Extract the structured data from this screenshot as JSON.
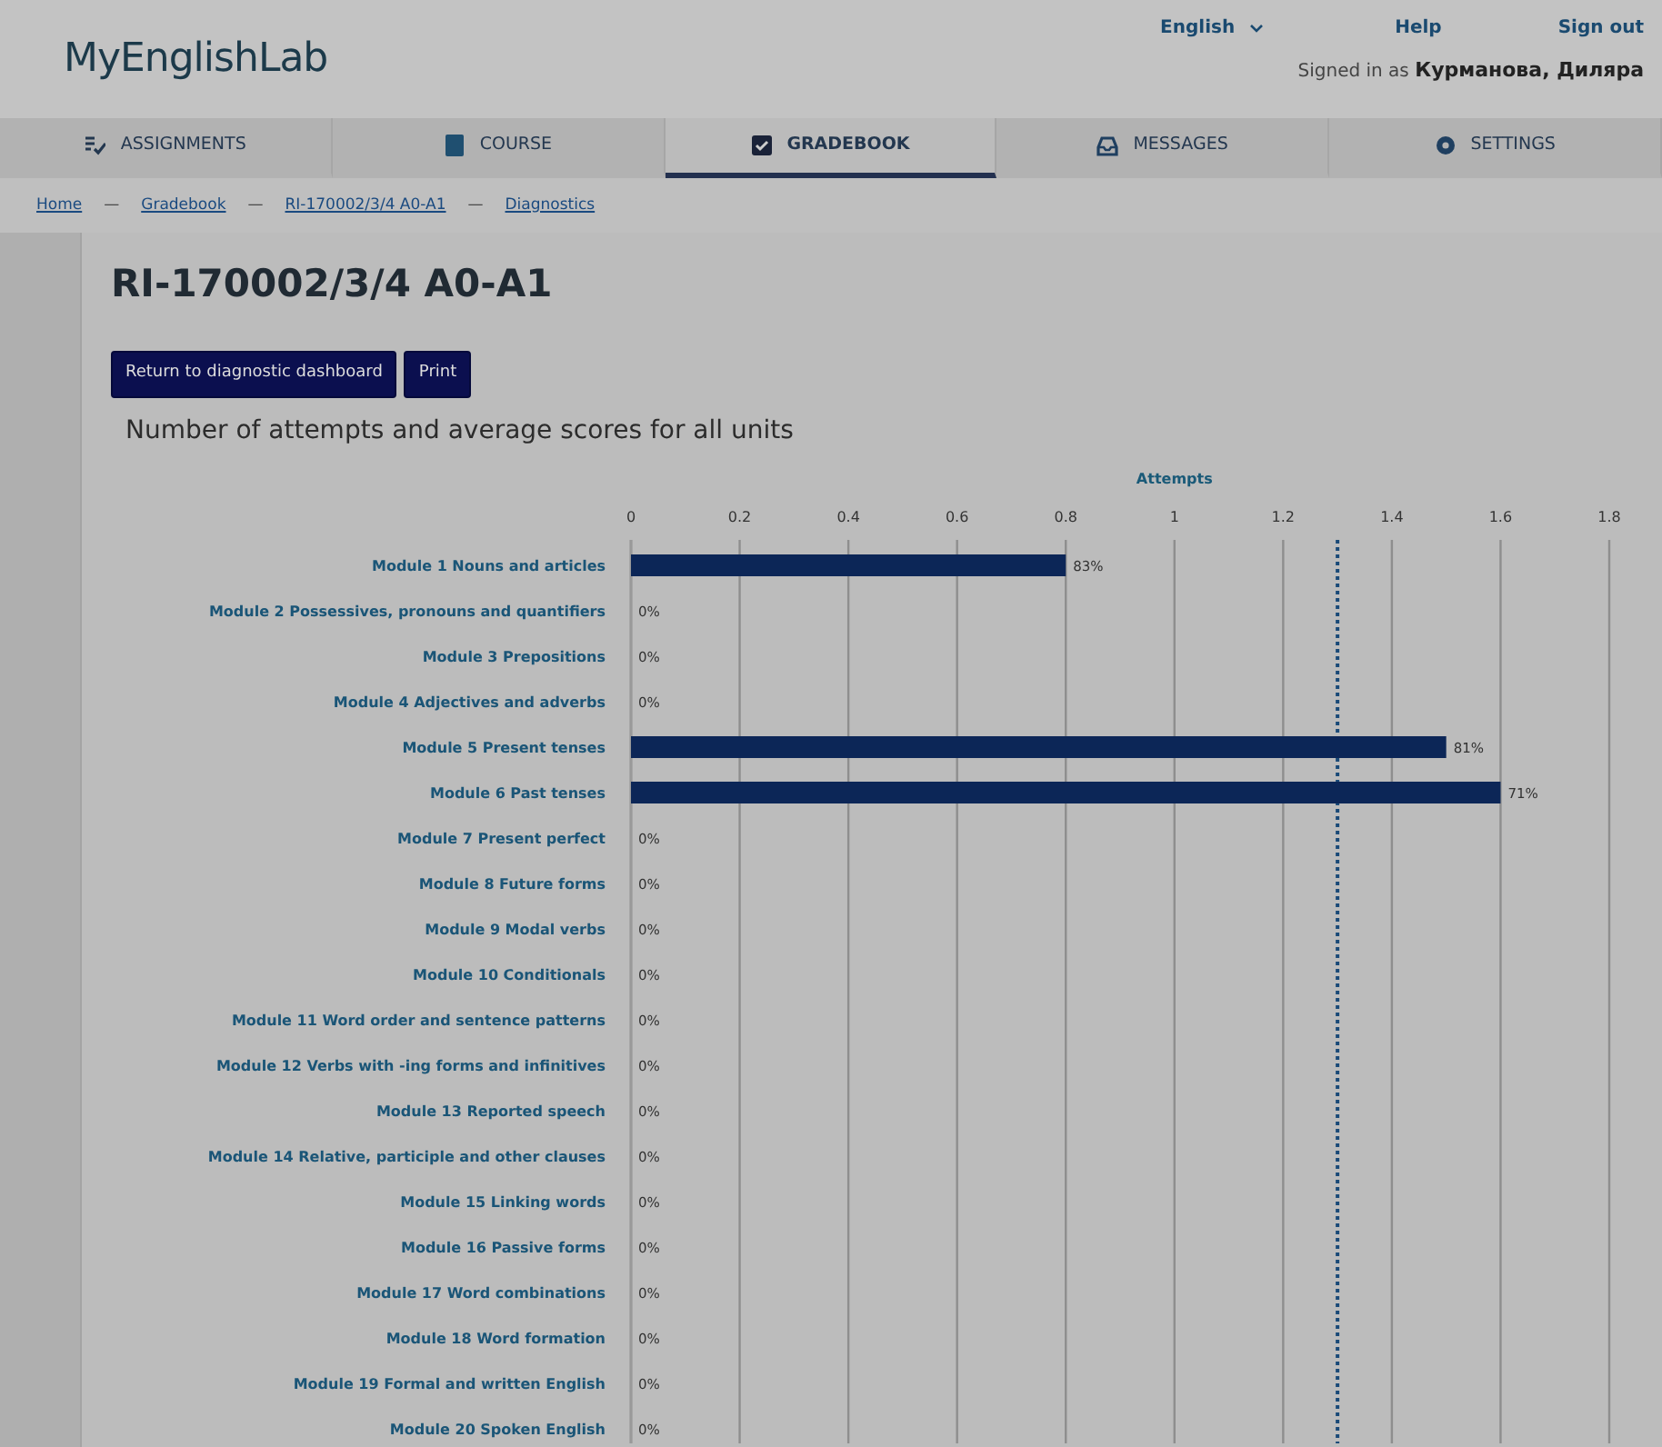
{
  "header": {
    "logo": "MyEnglishLab",
    "language": "English",
    "help": "Help",
    "sign_out": "Sign out",
    "signed_in_label": "Signed in as",
    "user_name": "Курманова, Диляра"
  },
  "tabs": [
    {
      "label": "ASSIGNMENTS",
      "selected": false
    },
    {
      "label": "COURSE",
      "selected": false
    },
    {
      "label": "GRADEBOOK",
      "selected": true
    },
    {
      "label": "MESSAGES",
      "selected": false
    },
    {
      "label": "SETTINGS",
      "selected": false
    }
  ],
  "breadcrumb": [
    {
      "kind": "link",
      "text": "Home"
    },
    {
      "kind": "separator",
      "text": "—"
    },
    {
      "kind": "link",
      "text": "Gradebook"
    },
    {
      "kind": "separator",
      "text": "—"
    },
    {
      "kind": "link",
      "text": "RI-170002/3/4 A0-A1"
    },
    {
      "kind": "separator",
      "text": "—"
    },
    {
      "kind": "link",
      "text": "Diagnostics"
    }
  ],
  "page_title": "RI-170002/3/4 A0-A1",
  "buttons": [
    "Return to diagnostic dashboard",
    "Print"
  ],
  "section_title": "Number of attempts and average scores for all units",
  "chart": {
    "score_labels": [
      "83%",
      "0%",
      "0%",
      "0%",
      "81%",
      "71%",
      "0%",
      "0%",
      "0%",
      "0%",
      "0%",
      "0%",
      "0%",
      "0%",
      "0%",
      "0%",
      "0%",
      "0%",
      "0%",
      "0%"
    ],
    "chart_data": {
      "type": "bar",
      "orientation": "horizontal",
      "xlabel": "Attempts",
      "categories": [
        "Module 1 Nouns and articles",
        "Module 2 Possessives, pronouns and quantifiers",
        "Module 3 Prepositions",
        "Module 4 Adjectives and adverbs",
        "Module 5 Present tenses",
        "Module 6 Past tenses",
        "Module 7 Present perfect",
        "Module 8 Future forms",
        "Module 9 Modal verbs",
        "Module 10 Conditionals",
        "Module 11 Word order and sentence patterns",
        "Module 12 Verbs with -ing forms and infinitives",
        "Module 13 Reported speech",
        "Module 14 Relative, participle and other clauses",
        "Module 15 Linking words",
        "Module 16 Passive forms",
        "Module 17 Word combinations",
        "Module 18 Word formation",
        "Module 19 Formal and written English",
        "Module 20 Spoken English"
      ],
      "values": [
        0.8,
        0,
        0,
        0,
        1.5,
        1.6,
        0,
        0,
        0,
        0,
        0,
        0,
        0,
        0,
        0,
        0,
        0,
        0,
        0,
        0
      ],
      "xlim": [
        0,
        1.8
      ],
      "grid": true,
      "xticks": [
        0,
        0.2,
        0.4,
        0.6,
        0.8,
        1,
        1.2,
        1.4,
        1.6,
        1.8
      ],
      "ref_lines": [
        {
          "axis": "x",
          "value": 1.3
        }
      ]
    }
  }
}
